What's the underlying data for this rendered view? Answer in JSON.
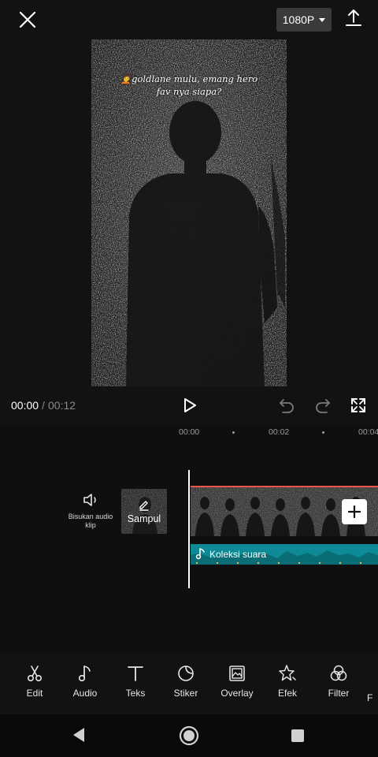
{
  "topbar": {
    "close_icon": "close-icon",
    "resolution_label": "1080P",
    "export_icon": "upload-icon"
  },
  "preview": {
    "caption_emoji": "🧑‍🦱",
    "caption_line1": "goldlane mulu, emang hero",
    "caption_line2": "fav nya siapa?"
  },
  "controls": {
    "current_time": "00:00",
    "separator": "/",
    "total_time": "00:12",
    "icons": [
      "play-icon",
      "undo-icon",
      "redo-icon",
      "fullscreen-icon"
    ]
  },
  "timeline": {
    "ruler": [
      "00:00",
      "00:02",
      "00:04"
    ],
    "mute_label": "Bisukan audio klip",
    "cover_label": "Sampul",
    "audio_label": "Koleksi suara",
    "accent_color": "#e8574a",
    "audio_color": "#0d8a96"
  },
  "toolbar": {
    "items": [
      {
        "label": "Edit",
        "icon": "scissors-icon"
      },
      {
        "label": "Audio",
        "icon": "music-note-icon"
      },
      {
        "label": "Teks",
        "icon": "text-icon"
      },
      {
        "label": "Stiker",
        "icon": "sticker-icon"
      },
      {
        "label": "Overlay",
        "icon": "overlay-icon"
      },
      {
        "label": "Efek",
        "icon": "effects-icon"
      },
      {
        "label": "Filter",
        "icon": "filter-icon"
      },
      {
        "label": "F",
        "icon": "partial-tool-icon"
      }
    ]
  },
  "navbar": {
    "icons": [
      "nav-back-icon",
      "nav-home-icon",
      "nav-recent-icon"
    ]
  }
}
